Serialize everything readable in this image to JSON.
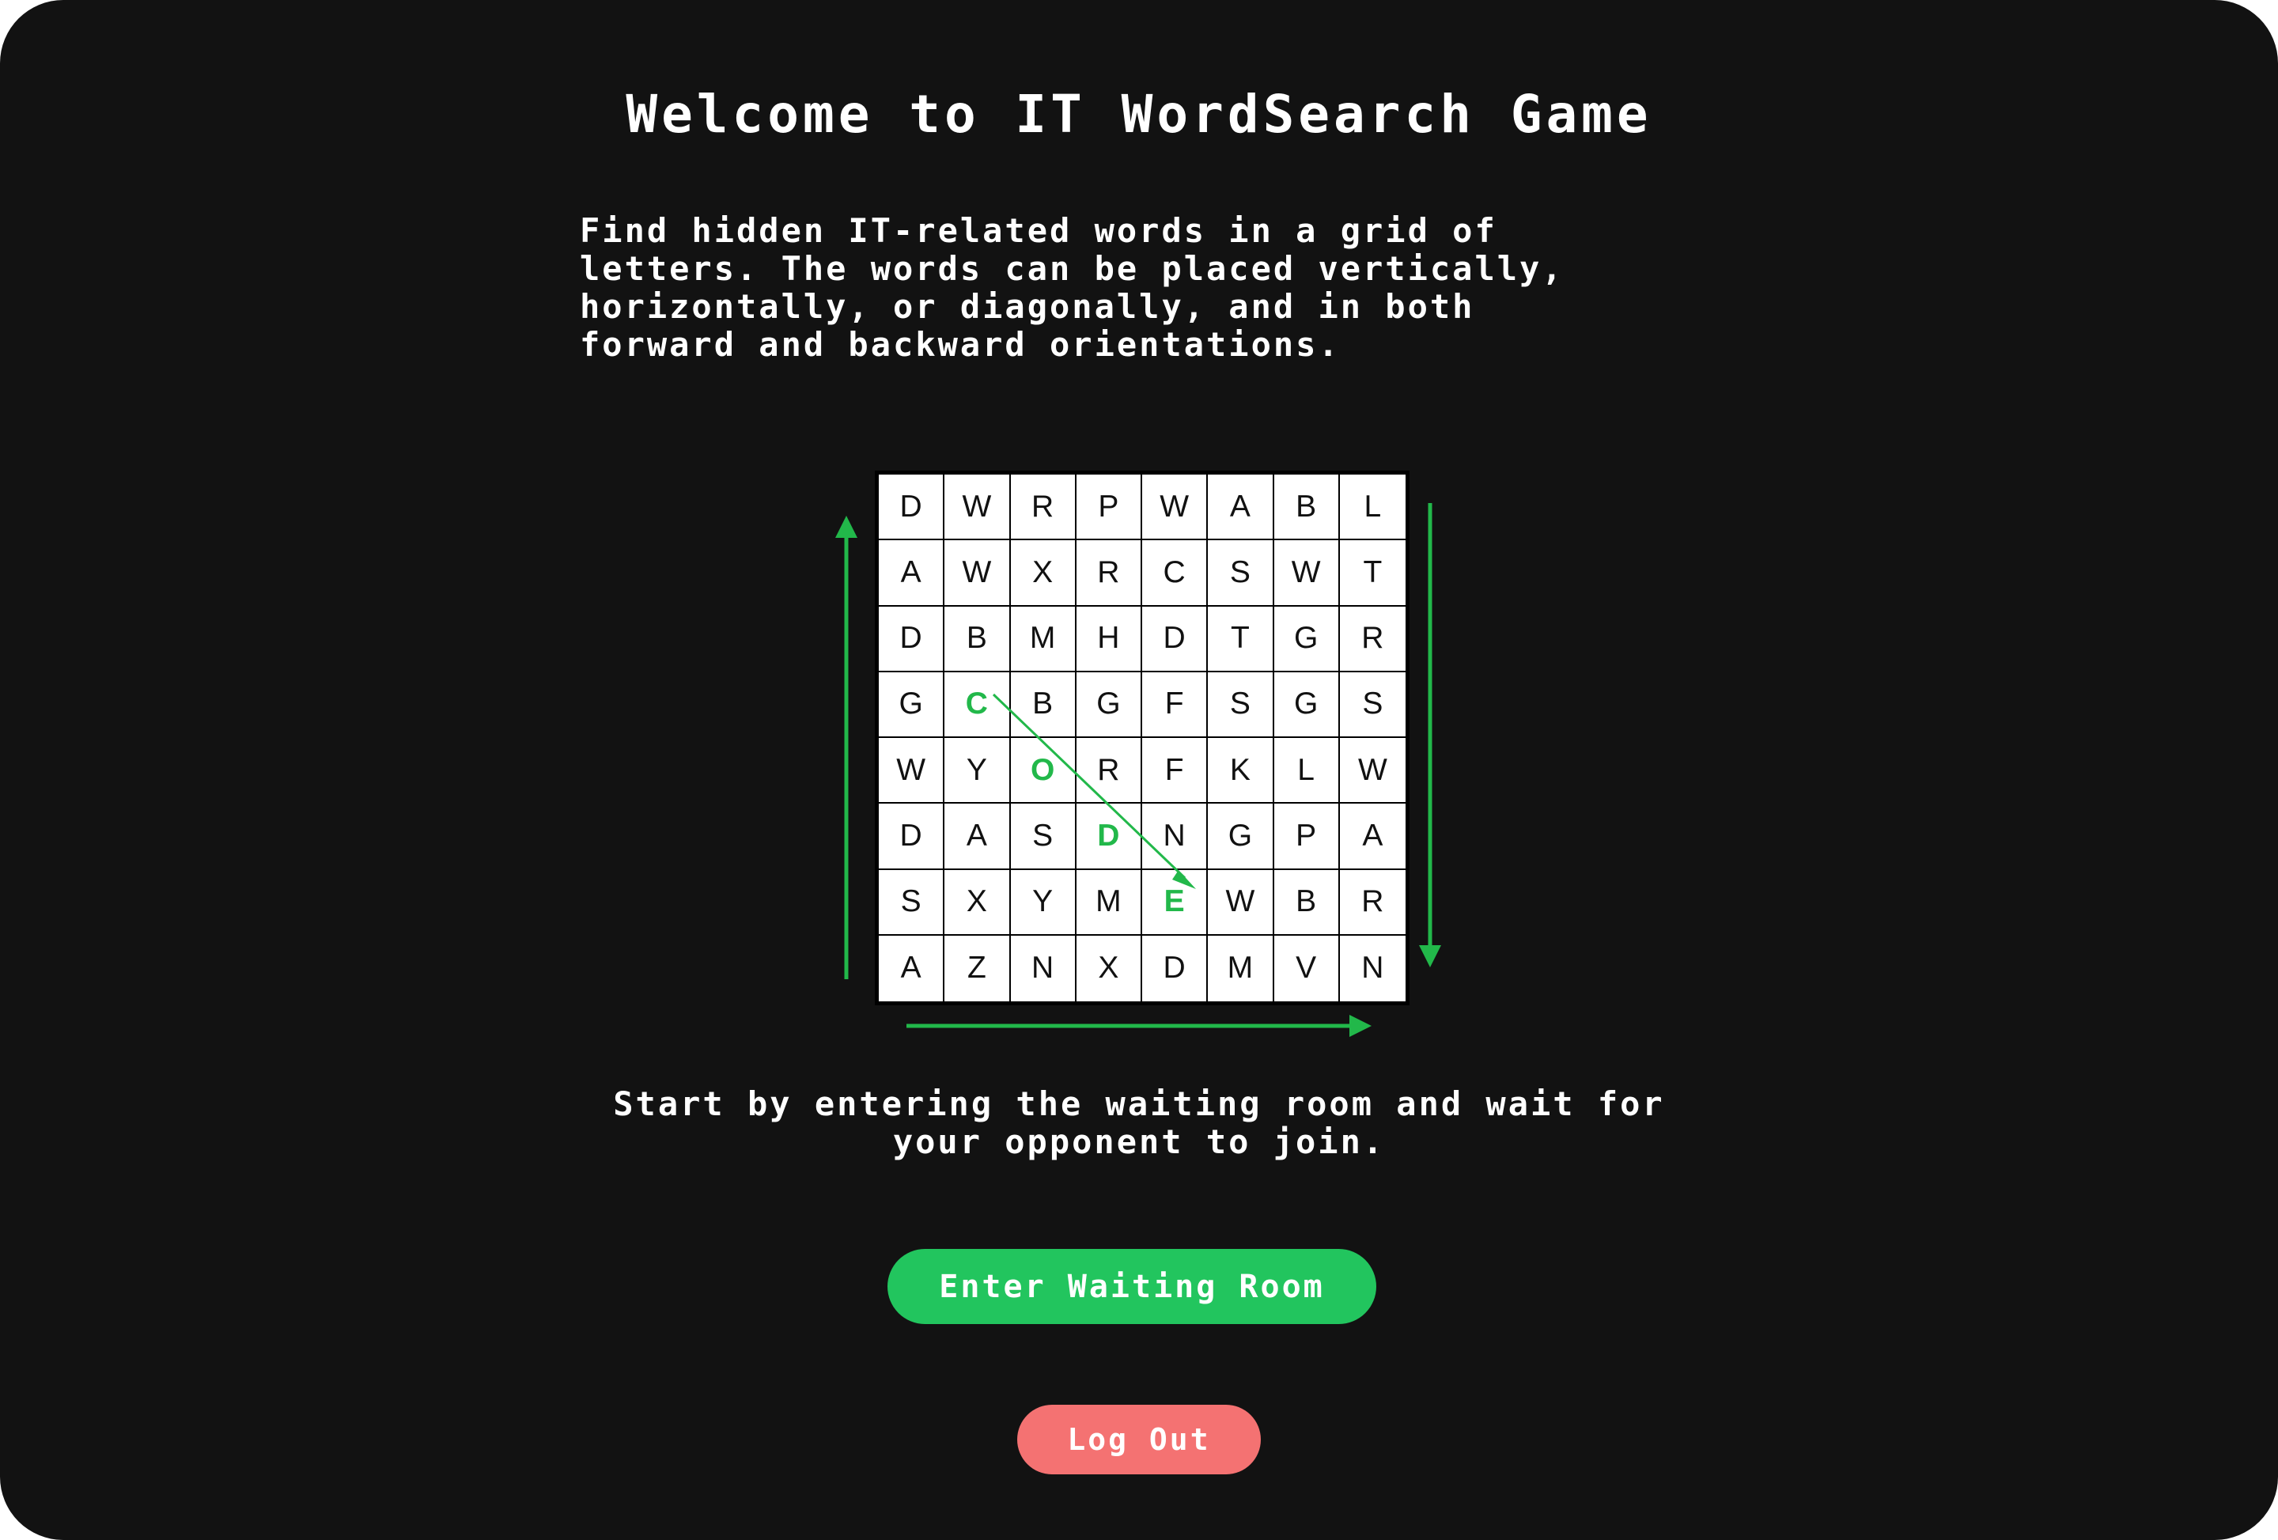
{
  "title": "Welcome to IT WordSearch Game",
  "description_lines": [
    "Find hidden IT-related words in a grid of",
    "letters. The words can be placed vertically,",
    "horizontally, or diagonally, and in both",
    "forward and backward orientations."
  ],
  "grid": {
    "rows": [
      [
        "D",
        "W",
        "R",
        "P",
        "W",
        "A",
        "B",
        "L"
      ],
      [
        "A",
        "W",
        "X",
        "R",
        "C",
        "S",
        "W",
        "T"
      ],
      [
        "D",
        "B",
        "M",
        "H",
        "D",
        "T",
        "G",
        "R"
      ],
      [
        "G",
        "C",
        "B",
        "G",
        "F",
        "S",
        "G",
        "S"
      ],
      [
        "W",
        "Y",
        "O",
        "R",
        "F",
        "K",
        "L",
        "W"
      ],
      [
        "D",
        "A",
        "S",
        "D",
        "N",
        "G",
        "P",
        "A"
      ],
      [
        "S",
        "X",
        "Y",
        "M",
        "E",
        "W",
        "B",
        "R"
      ],
      [
        "A",
        "Z",
        "N",
        "X",
        "D",
        "M",
        "V",
        "N"
      ]
    ],
    "highlight_word": "CODE",
    "highlight_cells": [
      [
        3,
        1
      ],
      [
        4,
        2
      ],
      [
        5,
        3
      ],
      [
        6,
        4
      ]
    ],
    "highlight_color": "#22b84a",
    "direction_arrows": [
      "up",
      "down",
      "right",
      "diagonal-down-right"
    ]
  },
  "instruction_lines": [
    "Start by entering the waiting room and wait for",
    "your opponent to join."
  ],
  "buttons": {
    "enter_waiting_room": "Enter Waiting Room",
    "log_out": "Log Out"
  },
  "colors": {
    "background": "#121212",
    "accent_green": "#22c55e",
    "logout_red": "#f47272",
    "text": "#ffffff"
  }
}
